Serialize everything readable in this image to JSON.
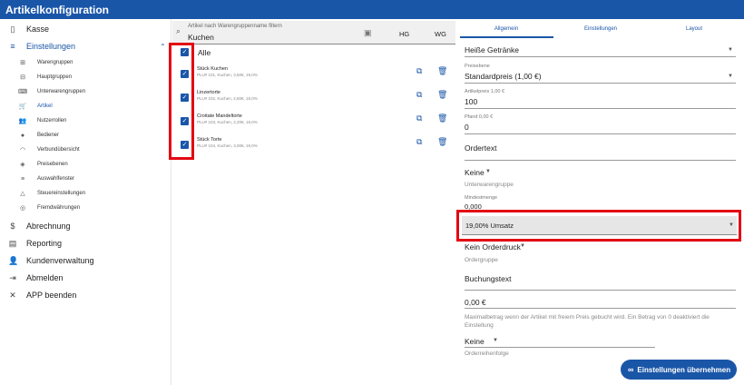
{
  "app": {
    "title": "Artikelkonfiguration"
  },
  "sidebar": {
    "top_items": [
      {
        "label": "Kasse",
        "icon": "tablet-icon"
      },
      {
        "label": "Einstellungen",
        "icon": "settings-list-icon"
      }
    ],
    "sub_items": [
      {
        "label": "Warengruppen",
        "icon": "grid-icon"
      },
      {
        "label": "Hauptgruppen",
        "icon": "box-icon"
      },
      {
        "label": "Unterwarengruppen",
        "icon": "keyboard-icon"
      },
      {
        "label": "Artikel",
        "icon": "cart-icon"
      },
      {
        "label": "Nutzerrollen",
        "icon": "people-icon"
      },
      {
        "label": "Bediener",
        "icon": "person-icon"
      },
      {
        "label": "Verbundübersicht",
        "icon": "wifi-icon"
      },
      {
        "label": "Preisebenen",
        "icon": "layers-icon"
      },
      {
        "label": "Auswahlfenster",
        "icon": "list-icon"
      },
      {
        "label": "Steuereinstellungen",
        "icon": "tax-icon"
      },
      {
        "label": "Fremdwährungen",
        "icon": "currency-icon"
      }
    ],
    "bottom_items": [
      {
        "label": "Abrechnung",
        "icon": "dollar-icon"
      },
      {
        "label": "Reporting",
        "icon": "report-icon"
      },
      {
        "label": "Kundenverwaltung",
        "icon": "customers-icon"
      },
      {
        "label": "Abmelden",
        "icon": "logout-icon"
      },
      {
        "label": "APP beenden",
        "icon": "close-icon"
      }
    ]
  },
  "filter": {
    "placeholder": "Artikel nach Warengruppenname filtern",
    "value": "Kuchen",
    "hg_label": "HG",
    "wg_label": "WG"
  },
  "articles": {
    "all_label": "Alle",
    "items": [
      {
        "name": "Stück Kuchen",
        "details": "PLU# 101, Kuchen, 3,50€, 19,0%"
      },
      {
        "name": "Linzertorte",
        "details": "PLU# 102, Kuchen, 2,50€, 19,0%"
      },
      {
        "name": "Croitate Mandeltorte",
        "details": "PLU# 103, Kuchen, 2,20€, 19,0%"
      },
      {
        "name": "Stück Torte",
        "details": "PLU# 104, Kuchen, 3,00€, 19,0%"
      }
    ]
  },
  "tabs": [
    "Allgemein",
    "Einstellungen",
    "Layout"
  ],
  "form": {
    "group": "Heiße Getränke",
    "price_level_label": "Preisebene",
    "price_level": "Standardpreis (1,00 €)",
    "price_label": "Artikelpreis 1,00 €",
    "price": "100",
    "deposit_label": "Pfand 0,00 €",
    "deposit": "0",
    "ordertext_label": "Ordertext",
    "subgroup_value": "Keine",
    "subgroup_label": "Unterwarengruppe",
    "min_qty_label": "Mindestmenge",
    "min_qty": "0,000",
    "tax": "19,00% Umsatz",
    "order_print": "Kein Orderdruck",
    "order_group_label": "Ordergruppe",
    "booking_text_label": "Buchungstext",
    "max_amount": "0,00 €",
    "max_amount_help": "Maximalbetrag wenn der Artikel mit freiem Preis gebucht wird. Ein Betrag von 0 deaktiviert die Einstellung",
    "order_sequence_value": "Keine",
    "order_sequence_label": "Orderreihenfolge"
  },
  "save_button": "Einstellungen übernehmen",
  "colors": {
    "primary": "#1a56a8",
    "highlight": "#e30613"
  }
}
